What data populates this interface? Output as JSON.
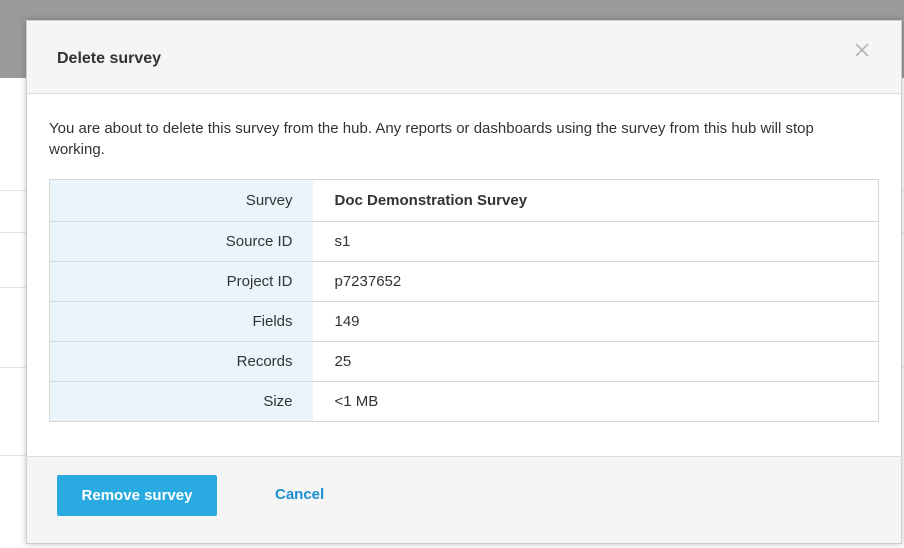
{
  "dialog": {
    "title": "Delete survey",
    "close_icon": "close-icon",
    "message": "You are about to delete this survey from the hub. Any reports or dashboards using the survey from this hub will stop working.",
    "details": [
      {
        "label": "Survey",
        "value": "Doc Demonstration Survey"
      },
      {
        "label": "Source ID",
        "value": "s1"
      },
      {
        "label": "Project ID",
        "value": "p7237652"
      },
      {
        "label": "Fields",
        "value": "149"
      },
      {
        "label": "Records",
        "value": "25"
      },
      {
        "label": "Size",
        "value": "<1 MB"
      }
    ],
    "primary_button": "Remove survey",
    "cancel_link": "Cancel"
  },
  "colors": {
    "primary": "#29abe2",
    "link": "#1a8fd1",
    "label_bg": "#eaf4fb",
    "header_bg": "#f5f5f5"
  }
}
